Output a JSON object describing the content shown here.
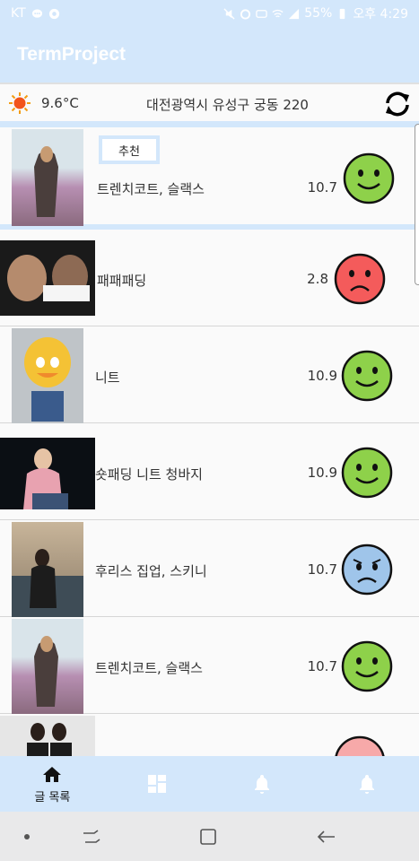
{
  "status_bar": {
    "carrier": "KT",
    "battery": "55%",
    "time": "오후 4:29"
  },
  "app_bar": {
    "title": "TermProject"
  },
  "weather": {
    "icon": "sun-icon",
    "temperature": "9.6°C",
    "location": "대전광역시 유성구 궁동 220",
    "refresh_icon": "refresh-icon"
  },
  "recommend_badge": "추천",
  "items": [
    {
      "label": "트렌치코트, 슬랙스",
      "temp": "10.7",
      "mood": "happy",
      "face_color": "#8ed14a"
    },
    {
      "label": "패패패딩",
      "temp": "2.8",
      "mood": "sad",
      "face_color": "#f45b5b"
    },
    {
      "label": "니트",
      "temp": "10.9",
      "mood": "happy",
      "face_color": "#8ed14a"
    },
    {
      "label": "숏패딩 니트 청바지",
      "temp": "10.9",
      "mood": "happy",
      "face_color": "#8ed14a"
    },
    {
      "label": "후리스 집업, 스키니",
      "temp": "10.7",
      "mood": "worried",
      "face_color": "#9fc5ea"
    },
    {
      "label": "트렌치코트, 슬랙스",
      "temp": "10.7",
      "mood": "happy",
      "face_color": "#8ed14a"
    },
    {
      "label": "",
      "temp": "",
      "mood": "partial",
      "face_color": "#f7a9a9"
    }
  ],
  "bottom_nav": {
    "home_label": "글 목록",
    "icons": [
      "home-icon",
      "dashboard-icon",
      "bell-icon",
      "bell-icon"
    ]
  },
  "colors": {
    "accent": "#d3e7fb",
    "happy": "#8ed14a",
    "sad": "#f45b5b",
    "worried": "#9fc5ea"
  }
}
